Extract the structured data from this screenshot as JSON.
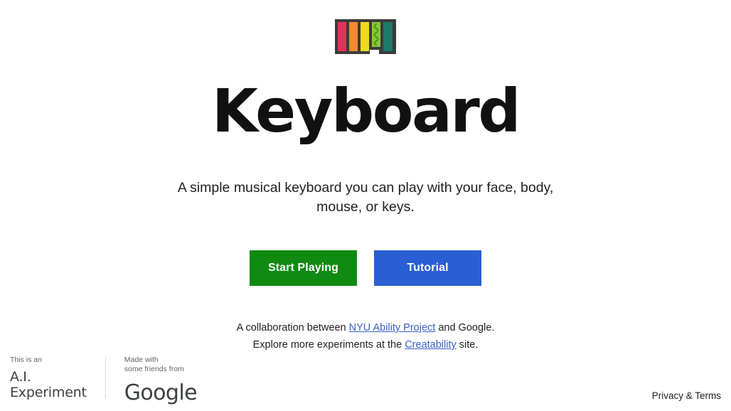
{
  "page": {
    "background": "#ffffff",
    "title": "Keyboard",
    "subtitle": "A simple musical keyboard you can play with your face, body, mouse, or keys."
  },
  "logo": {
    "name": "keyboard-logo",
    "outline_color": "#3b3b3b",
    "bars": [
      {
        "name": "bar-pink",
        "color": "#e8305a"
      },
      {
        "name": "bar-orange",
        "color": "#f58a2e"
      },
      {
        "name": "bar-yellow",
        "color": "#f0d91e"
      },
      {
        "name": "bar-green",
        "color": "#8cc63f",
        "squiggle": true,
        "squiggle_color": "#4a9a1e"
      },
      {
        "name": "bar-teal",
        "color": "#1b7a6b"
      }
    ]
  },
  "buttons": {
    "start": {
      "label": "Start Playing",
      "color": "#108a10"
    },
    "tutorial": {
      "label": "Tutorial",
      "color": "#2a5fd4"
    }
  },
  "credits": {
    "line1_before": "A collaboration between ",
    "line1_link": "NYU Ability Project",
    "line1_after": " and Google.",
    "line2_before": "Explore more experiments at the ",
    "line2_link": "Creatability",
    "line2_after": " site.",
    "link_color": "#3a5fc8"
  },
  "ai_badge": {
    "small_text": "This is an",
    "big_line1": "A.I.",
    "big_line2": "Experiment",
    "made_with_line1": "Made with",
    "made_with_line2": "some friends from",
    "google_wordmark": "Google"
  },
  "footer": {
    "privacy_terms": "Privacy & Terms"
  }
}
